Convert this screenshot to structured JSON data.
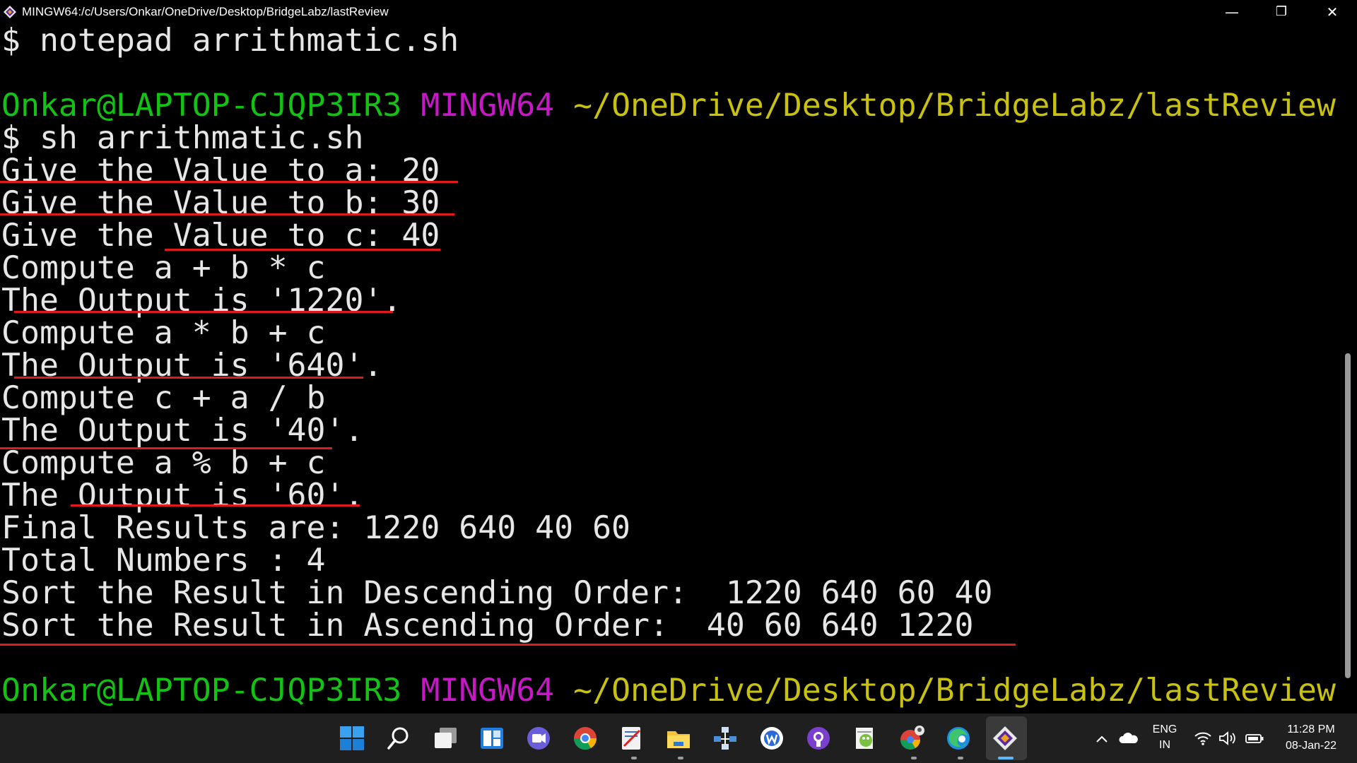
{
  "window": {
    "title": "MINGW64:/c/Users/Onkar/OneDrive/Desktop/BridgeLabz/lastReview",
    "minimize": "—",
    "maximize": "❐",
    "close": "✕"
  },
  "terminal": {
    "lines": [
      "$ notepad arrithmatic.sh",
      "",
      {
        "user": "Onkar@LAPTOP-CJQP3IR3",
        "shell": "MINGW64",
        "path": "~/OneDrive/Desktop/BridgeLabz/lastReview"
      },
      "$ sh arrithmatic.sh",
      "Give the Value to a: 20",
      "Give the Value to b: 30",
      "Give the Value to c: 40",
      "Compute a + b * c",
      "The Output is '1220'.",
      "Compute a * b + c",
      "The Output is '640'.",
      "Compute c + a / b",
      "The Output is '40'.",
      "Compute a % b + c",
      "The Output is '60'.",
      "Final Results are: 1220 640 40 60",
      "Total Numbers : 4",
      "Sort the Result in Descending Order:  1220 640 60 40",
      "Sort the Result in Ascending Order:  40 60 640 1220",
      "",
      {
        "user": "Onkar@LAPTOP-CJQP3IR3",
        "shell": "MINGW64",
        "path": "~/OneDrive/Desktop/BridgeLabz/lastReview"
      }
    ],
    "colors": {
      "user": "#13c313",
      "shell": "#c717c7",
      "path": "#c8c10f",
      "text": "#e6e6e6",
      "annotation": "#e01a1a"
    }
  },
  "taskbar": {
    "icons": [
      "start-icon",
      "search-icon",
      "task-view-icon",
      "widgets-icon",
      "teams-chat-icon",
      "chrome-icon",
      "snipping-tool-icon",
      "file-explorer-icon",
      "network-app-icon",
      "wps-icon",
      "github-desktop-icon",
      "notepad-plus-plus-icon",
      "chrome-profile-icon",
      "edge-icon",
      "git-bash-icon"
    ],
    "tray": {
      "lang_top": "ENG",
      "lang_bottom": "IN",
      "time": "11:28 PM",
      "date": "08-Jan-22"
    }
  }
}
